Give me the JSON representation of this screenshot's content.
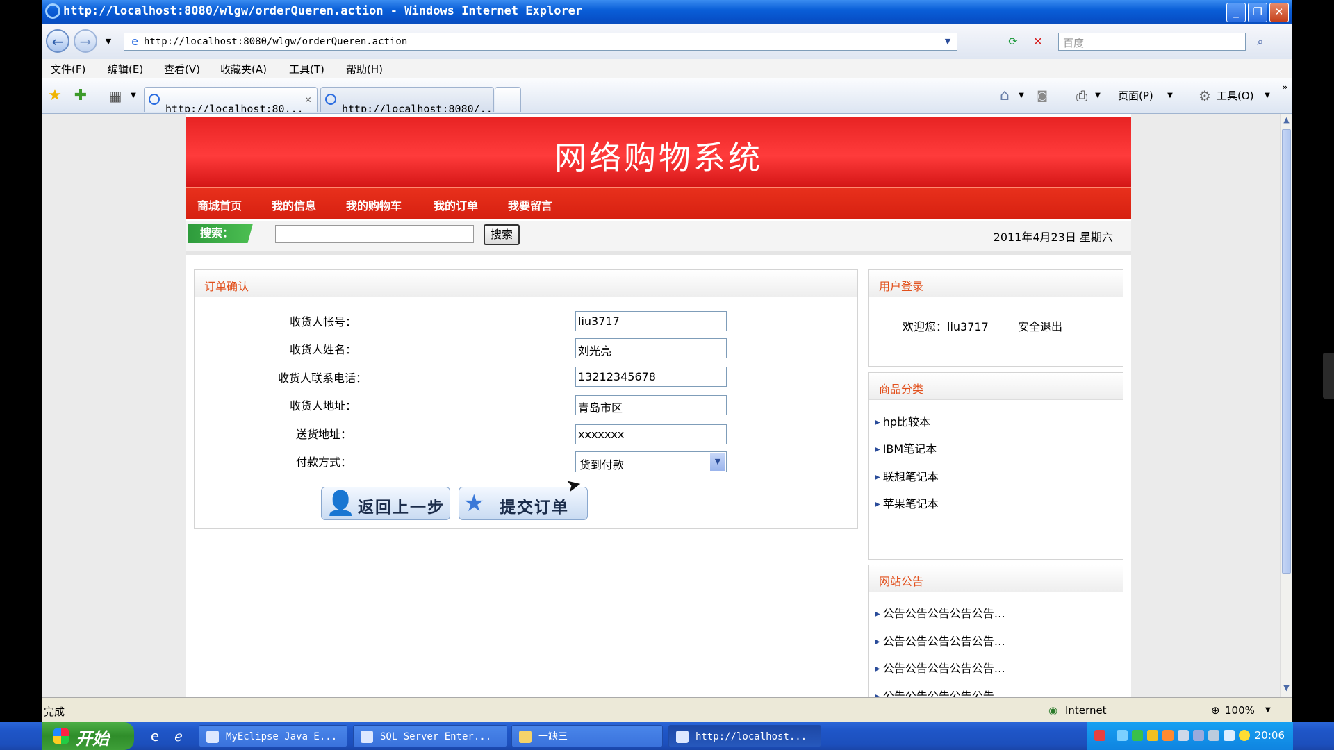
{
  "window": {
    "title": "http://localhost:8080/wlgw/orderQueren.action - Windows Internet Explorer",
    "address": "http://localhost:8080/wlgw/orderQueren.action",
    "search_placeholder": "百度",
    "menu": [
      "文件(F)",
      "编辑(E)",
      "查看(V)",
      "收藏夹(A)",
      "工具(T)",
      "帮助(H)"
    ],
    "tabs": [
      {
        "label": "http://localhost:80..."
      },
      {
        "label": "http://localhost:8080/..."
      }
    ],
    "cmdbar": {
      "page_label": "页面(P)",
      "tools_label": "工具(O)"
    }
  },
  "site": {
    "title": "网络购物系统",
    "nav": [
      "商城首页",
      "我的信息",
      "我的购物车",
      "我的订单",
      "我要留言"
    ],
    "search_label": "搜索：",
    "search_button": "搜索",
    "date": "2011年4月23日 星期六"
  },
  "order_form": {
    "heading": "订单确认",
    "fields": [
      {
        "label": "收货人帐号：",
        "value": "liu3717"
      },
      {
        "label": "收货人姓名：",
        "value": "刘光亮"
      },
      {
        "label": "收货人联系电话：",
        "value": "13212345678"
      },
      {
        "label": "收货人地址：",
        "value": "青岛市区"
      },
      {
        "label": "送货地址：",
        "value": "xxxxxxx"
      },
      {
        "label": "付款方式：",
        "value": "货到付款"
      }
    ],
    "back_button": "返回上一步",
    "submit_button": "提交订单"
  },
  "sidebar": {
    "login": {
      "heading": "用户登录",
      "welcome": "欢迎您：liu3717",
      "logout": "安全退出"
    },
    "categories": {
      "heading": "商品分类",
      "items": [
        "hp比较本",
        "IBM笔记本",
        "联想笔记本",
        "苹果笔记本"
      ]
    },
    "notices": {
      "heading": "网站公告",
      "items": [
        "公告公告公告公告公告…",
        "公告公告公告公告公告…",
        "公告公告公告公告公告…",
        "公告公告公告公告公告…"
      ]
    }
  },
  "statusbar": {
    "status": "完成",
    "zone": "Internet",
    "zoom": "100%"
  },
  "taskbar": {
    "start": "开始",
    "buttons": [
      "MyEclipse Java E...",
      "SQL Server Enter...",
      "一缺三",
      "http://localhost..."
    ],
    "clock": "20:06"
  },
  "colors": {
    "banner_red": "#e82424",
    "nav_red": "#d62010",
    "search_green": "#2e9b3c",
    "panel_heading": "#e2501c"
  }
}
